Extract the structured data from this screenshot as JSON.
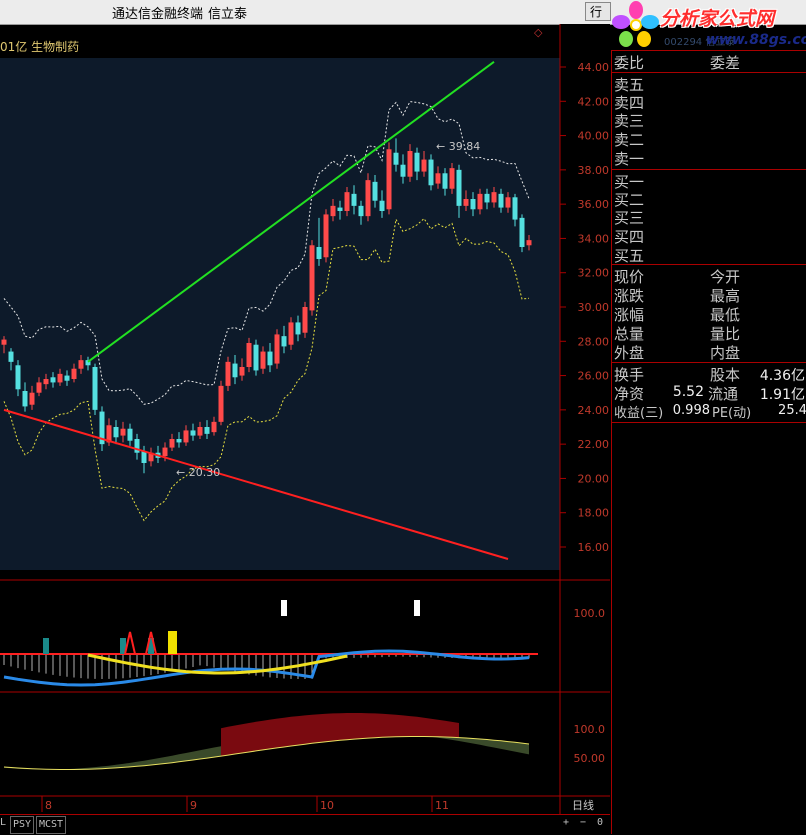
{
  "titlebar": {
    "app_name": "通达信金融终端",
    "stock_name": "信立泰",
    "row_button": "行"
  },
  "logo": {
    "site_name": "分析家公式网",
    "url": "www.88gs.com",
    "faint_code": "002294 信立泰"
  },
  "chart": {
    "header": "01亿 生物制药",
    "main_axis": [
      "44.00",
      "42.00",
      "40.00",
      "38.00",
      "36.00",
      "34.00",
      "32.00",
      "30.00",
      "28.00",
      "26.00",
      "24.00",
      "22.00",
      "20.00",
      "18.00",
      "16.00"
    ],
    "high_label": "39.84",
    "low_label": "20.30",
    "ind1_axis": [
      "100.0"
    ],
    "ind2_axis": [
      "100.0",
      "50.00"
    ],
    "months": [
      "8",
      "9",
      "10",
      "11"
    ],
    "period": "日线",
    "marker": "◇"
  },
  "chart_data": {
    "type": "candlestick",
    "y_range": [
      15.0,
      44.5
    ],
    "high": 39.84,
    "low": 20.3,
    "candles": [
      [
        27.8,
        28.1,
        27.3,
        28.3
      ],
      [
        27.4,
        26.8,
        26.3,
        27.6
      ],
      [
        26.6,
        25.2,
        24.8,
        26.9
      ],
      [
        25.1,
        24.2,
        23.9,
        25.6
      ],
      [
        24.3,
        25.0,
        24.0,
        25.4
      ],
      [
        25.0,
        25.6,
        24.8,
        25.9
      ],
      [
        25.5,
        25.8,
        25.2,
        26.1
      ],
      [
        25.9,
        25.6,
        25.3,
        26.2
      ],
      [
        25.6,
        26.1,
        25.4,
        26.4
      ],
      [
        26.0,
        25.7,
        25.4,
        26.3
      ],
      [
        25.8,
        26.4,
        25.6,
        26.7
      ],
      [
        26.4,
        26.9,
        26.1,
        27.2
      ],
      [
        26.9,
        26.6,
        26.3,
        27.1
      ],
      [
        26.5,
        24.0,
        23.7,
        26.7
      ],
      [
        23.9,
        22.0,
        21.6,
        24.2
      ],
      [
        22.1,
        23.1,
        21.9,
        23.5
      ],
      [
        23.0,
        22.4,
        22.0,
        23.4
      ],
      [
        22.5,
        22.9,
        22.1,
        23.3
      ],
      [
        22.9,
        22.2,
        21.9,
        23.2
      ],
      [
        22.3,
        21.5,
        21.1,
        22.6
      ],
      [
        21.6,
        20.9,
        20.3,
        21.9
      ],
      [
        21.0,
        21.5,
        20.7,
        21.8
      ],
      [
        21.5,
        21.2,
        20.9,
        21.9
      ],
      [
        21.3,
        21.8,
        21.0,
        22.1
      ],
      [
        21.8,
        22.3,
        21.6,
        22.6
      ],
      [
        22.3,
        22.1,
        21.8,
        22.7
      ],
      [
        22.1,
        22.8,
        21.9,
        23.1
      ],
      [
        22.8,
        22.5,
        22.2,
        23.2
      ],
      [
        22.5,
        23.0,
        22.3,
        23.3
      ],
      [
        23.0,
        22.6,
        22.3,
        23.4
      ],
      [
        22.7,
        23.3,
        22.5,
        23.6
      ],
      [
        23.3,
        25.4,
        23.1,
        25.7
      ],
      [
        25.4,
        26.8,
        25.1,
        27.1
      ],
      [
        26.7,
        25.9,
        25.5,
        27.2
      ],
      [
        26.0,
        26.5,
        25.7,
        27.0
      ],
      [
        26.5,
        27.9,
        26.2,
        28.2
      ],
      [
        27.8,
        26.3,
        26.0,
        28.1
      ],
      [
        26.4,
        27.4,
        26.1,
        27.7
      ],
      [
        27.4,
        26.6,
        26.2,
        27.9
      ],
      [
        26.7,
        28.4,
        26.4,
        28.7
      ],
      [
        28.3,
        27.7,
        27.3,
        28.9
      ],
      [
        27.8,
        29.1,
        27.5,
        29.4
      ],
      [
        29.1,
        28.4,
        28.0,
        29.5
      ],
      [
        28.5,
        30.0,
        28.2,
        30.3
      ],
      [
        29.8,
        33.6,
        29.5,
        33.9
      ],
      [
        33.5,
        32.8,
        32.4,
        35.2
      ],
      [
        32.9,
        35.4,
        32.6,
        35.7
      ],
      [
        35.3,
        35.9,
        35.0,
        36.3
      ],
      [
        35.8,
        35.6,
        35.1,
        36.2
      ],
      [
        35.6,
        36.7,
        35.3,
        37.0
      ],
      [
        36.6,
        35.9,
        35.4,
        37.1
      ],
      [
        35.9,
        35.3,
        34.8,
        36.2
      ],
      [
        35.3,
        37.4,
        35.0,
        37.8
      ],
      [
        37.3,
        36.2,
        35.8,
        37.7
      ],
      [
        36.2,
        35.6,
        35.2,
        36.8
      ],
      [
        35.7,
        39.2,
        35.4,
        39.6
      ],
      [
        39.0,
        38.3,
        37.9,
        39.84
      ],
      [
        38.3,
        37.6,
        37.2,
        38.9
      ],
      [
        37.6,
        39.1,
        37.3,
        39.5
      ],
      [
        39.0,
        37.9,
        37.4,
        39.3
      ],
      [
        37.9,
        38.6,
        37.6,
        39.1
      ],
      [
        38.6,
        37.1,
        36.8,
        38.9
      ],
      [
        37.2,
        37.8,
        36.9,
        38.2
      ],
      [
        37.8,
        36.9,
        36.5,
        38.1
      ],
      [
        36.9,
        38.1,
        36.6,
        38.4
      ],
      [
        38.0,
        35.9,
        35.2,
        38.3
      ],
      [
        35.9,
        36.3,
        35.6,
        36.8
      ],
      [
        36.3,
        35.7,
        35.3,
        36.7
      ],
      [
        35.7,
        36.6,
        35.4,
        36.9
      ],
      [
        36.6,
        36.1,
        35.7,
        36.9
      ],
      [
        36.1,
        36.7,
        35.8,
        37.0
      ],
      [
        36.6,
        35.8,
        35.5,
        36.9
      ],
      [
        35.8,
        36.4,
        35.5,
        36.7
      ],
      [
        36.4,
        35.1,
        34.7,
        36.6
      ],
      [
        35.2,
        33.5,
        33.2,
        35.4
      ],
      [
        33.6,
        33.9,
        33.3,
        34.2
      ]
    ],
    "series": [
      {
        "name": "support line",
        "color": "#ff2020",
        "points": [
          [
            0,
            24.0
          ],
          [
            72,
            15.3
          ]
        ]
      },
      {
        "name": "resistance line",
        "color": "#22e022",
        "points": [
          [
            12,
            26.8
          ],
          [
            70,
            44.3
          ]
        ]
      }
    ],
    "indicator_markers": {
      "white_bars_x": [
        40,
        59
      ],
      "teal_bars_x": [
        6,
        17,
        21
      ],
      "yellow_bar_x": [
        24
      ],
      "red_peaks_x": [
        18,
        21
      ]
    }
  }
}
